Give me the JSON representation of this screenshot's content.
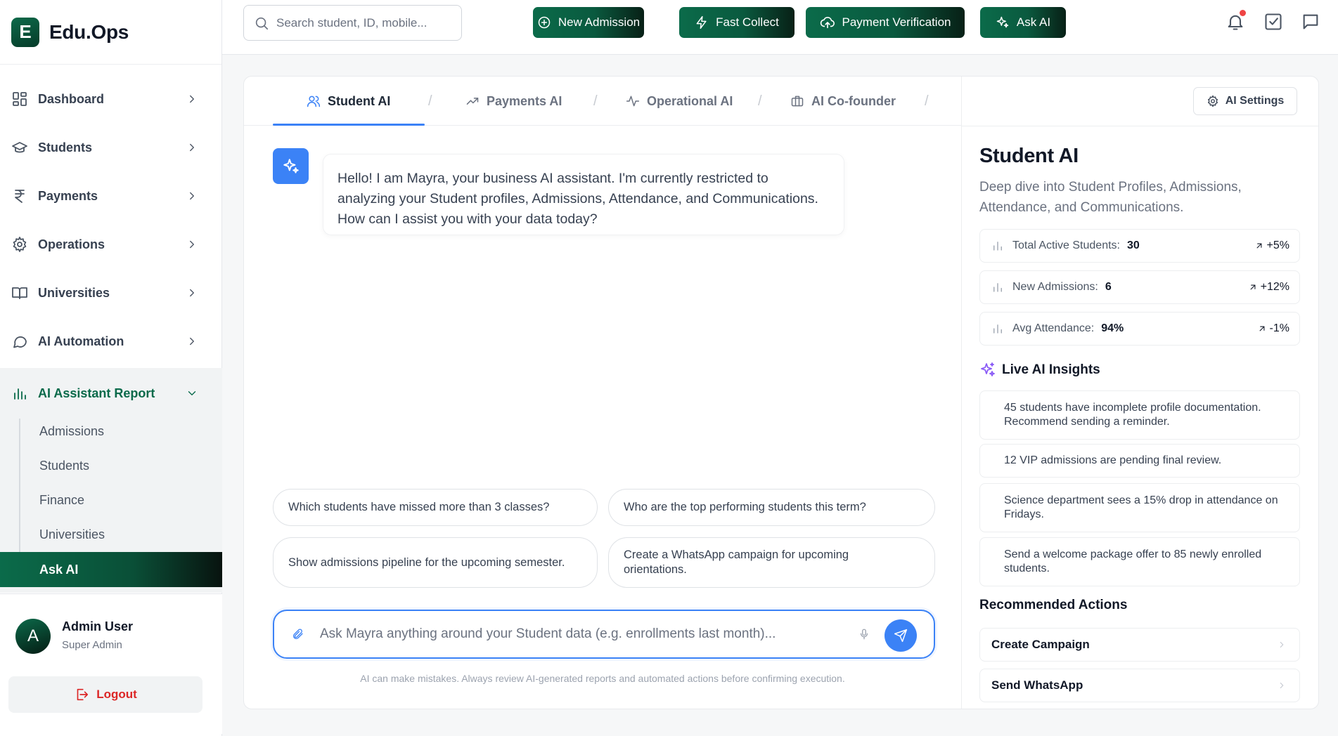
{
  "brand": {
    "logo_letter": "E",
    "name": "Edu.Ops"
  },
  "sidebar": {
    "items": [
      {
        "label": "Dashboard",
        "icon": "grid-icon"
      },
      {
        "label": "Students",
        "icon": "graduation-cap-icon"
      },
      {
        "label": "Payments",
        "icon": "rupee-icon"
      },
      {
        "label": "Operations",
        "icon": "gear-icon"
      },
      {
        "label": "Universities",
        "icon": "book-open-icon"
      },
      {
        "label": "AI Automation",
        "icon": "chat-bubble-icon"
      },
      {
        "label": "AI Assistant Report",
        "icon": "bar-chart-icon",
        "active": true
      }
    ],
    "submenu": [
      "Admissions",
      "Students",
      "Finance",
      "Universities",
      "Ask AI"
    ],
    "submenu_active": "Ask AI"
  },
  "user": {
    "initial": "A",
    "name": "Admin User",
    "role": "Super Admin",
    "logout_label": "Logout"
  },
  "topbar": {
    "search_placeholder": "Search student, ID, mobile...",
    "buttons": [
      {
        "label": "New Admission",
        "icon": "plus-circle-icon"
      },
      {
        "label": "Fast Collect",
        "icon": "lightning-icon"
      },
      {
        "label": "Payment Verification",
        "icon": "cloud-upload-icon"
      },
      {
        "label": "Ask AI",
        "icon": "sparkles-icon"
      }
    ]
  },
  "tabs": [
    {
      "label": "Student AI",
      "icon": "users-icon",
      "active": true
    },
    {
      "label": "Payments AI",
      "icon": "trending-up-icon"
    },
    {
      "label": "Operational AI",
      "icon": "activity-icon"
    },
    {
      "label": "AI Co-founder",
      "icon": "briefcase-icon"
    }
  ],
  "chat": {
    "greeting": "Hello! I am Mayra, your business AI assistant. I'm currently restricted to analyzing your Student profiles, Admissions, Attendance, and Communications. How can I assist you with your data today?",
    "suggestions": [
      "Which students have missed more than 3 classes?",
      "Who are the top performing students this term?",
      "Show admissions pipeline for the upcoming semester.",
      "Create a WhatsApp campaign for upcoming orientations."
    ],
    "input_placeholder": "Ask Mayra anything around your Student data (e.g. enrollments last month)...",
    "disclaimer": "AI can make mistakes. Always review AI-generated reports and automated actions before confirming execution."
  },
  "panel": {
    "settings_label": "AI Settings",
    "title": "Student AI",
    "description": "Deep dive into Student Profiles, Admissions, Attendance, and Communications.",
    "stats": [
      {
        "label": "Total Active Students:",
        "value": "30",
        "trend": "+5%"
      },
      {
        "label": "New Admissions:",
        "value": "6",
        "trend": "+12%"
      },
      {
        "label": "Avg Attendance:",
        "value": "94%",
        "trend": "-1%"
      }
    ],
    "insights_title": "Live AI Insights",
    "insights": [
      "45 students have incomplete profile documentation. Recommend sending a reminder.",
      "12 VIP admissions are pending final review.",
      "Science department sees a 15% drop in attendance on Fridays.",
      "Send a welcome package offer to 85 newly enrolled students."
    ],
    "recommended_title": "Recommended Actions",
    "actions": [
      "Create Campaign",
      "Send WhatsApp"
    ]
  },
  "colors": {
    "brand_green": "#0b6b4a",
    "accent_blue": "#3b82f6",
    "danger_red": "#dc2626",
    "insight_purple": "#8b5cf6"
  }
}
